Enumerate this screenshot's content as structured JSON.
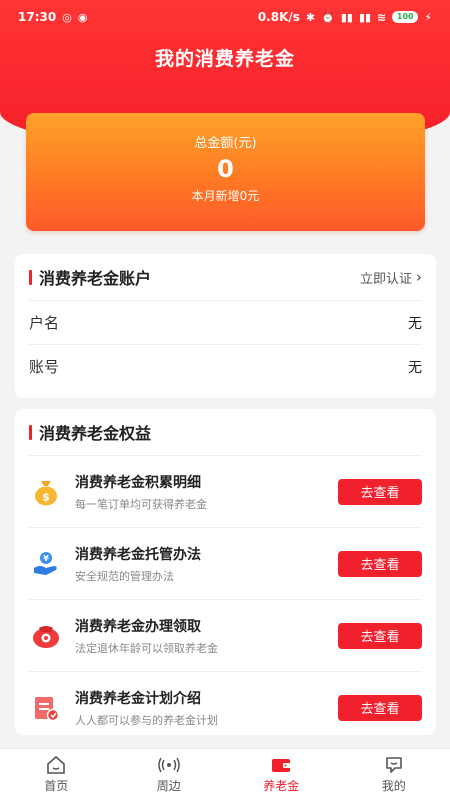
{
  "status_bar": {
    "time": "17:30",
    "speed": "0.8K/s",
    "battery": "100"
  },
  "header": {
    "title": "我的消费养老金"
  },
  "total_card": {
    "label": "总金额(元)",
    "value": "0",
    "subtitle": "本月新增0元"
  },
  "account": {
    "title": "消费养老金账户",
    "verify_label": "立即认证",
    "rows": [
      {
        "label": "户名",
        "value": "无"
      },
      {
        "label": "账号",
        "value": "无"
      }
    ]
  },
  "rights": {
    "title": "消费养老金权益",
    "button_label": "去查看",
    "items": [
      {
        "title": "消费养老金积累明细",
        "subtitle": "每一笔订单均可获得养老金",
        "icon": "money-bag-icon"
      },
      {
        "title": "消费养老金托管办法",
        "subtitle": "安全规范的管理办法",
        "icon": "hand-coin-icon"
      },
      {
        "title": "消费养老金办理领取",
        "subtitle": "法定退休年龄可以领取养老金",
        "icon": "red-envelope-icon"
      },
      {
        "title": "消费养老金计划介绍",
        "subtitle": "人人都可以参与的养老金计划",
        "icon": "plan-document-icon"
      }
    ]
  },
  "bottom_nav": {
    "items": [
      {
        "label": "首页",
        "icon": "home-icon"
      },
      {
        "label": "周边",
        "icon": "broadcast-icon"
      },
      {
        "label": "养老金",
        "icon": "wallet-icon",
        "active": true
      },
      {
        "label": "我的",
        "icon": "chat-bubble-icon"
      }
    ]
  },
  "colors": {
    "primary_red": "#f0202c",
    "card_orange": "#ff7a24"
  }
}
